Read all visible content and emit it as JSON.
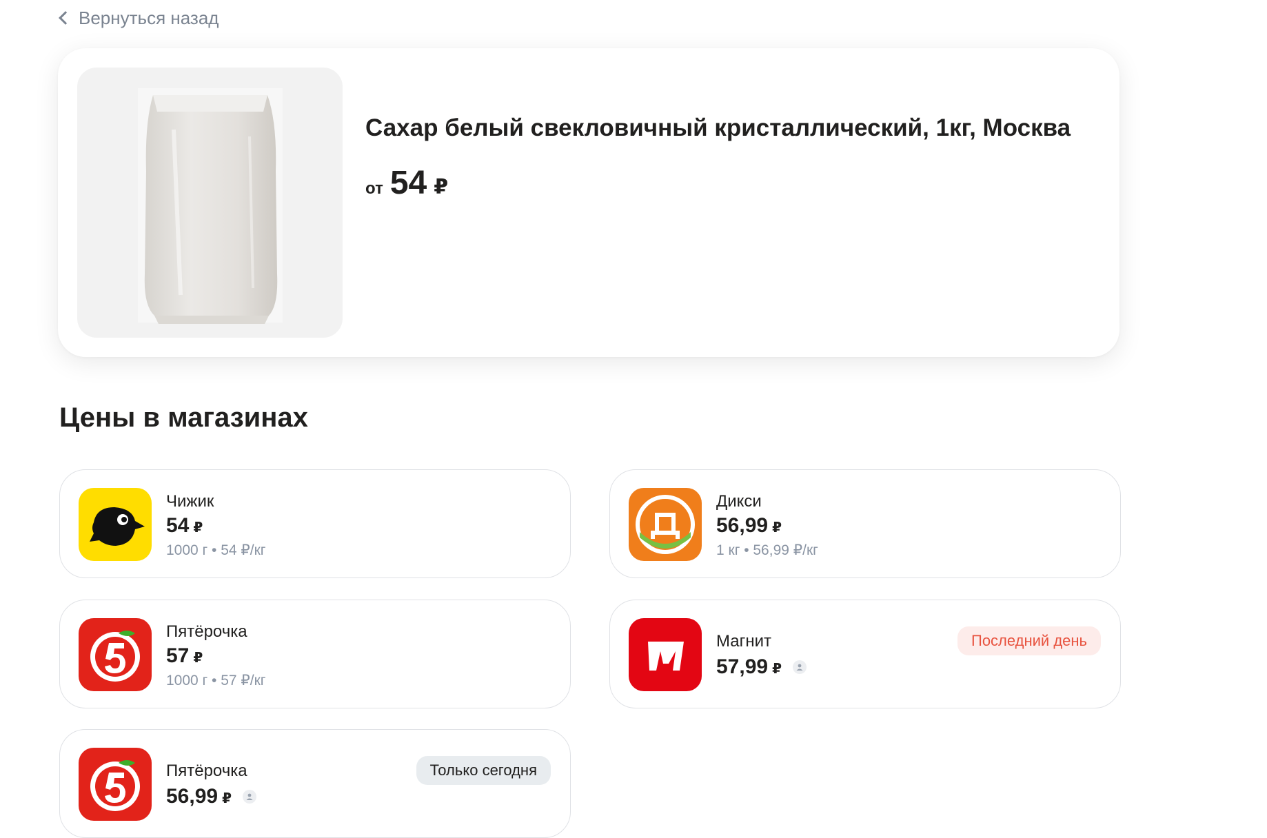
{
  "nav": {
    "back_label": "Вернуться назад"
  },
  "product": {
    "title": "Сахар белый свекловичный кристаллический, 1кг, Москва",
    "price_prefix": "от",
    "price_value": "54",
    "currency": "₽"
  },
  "section": {
    "title": "Цены в магазинах"
  },
  "offers": [
    {
      "store": "Чижик",
      "price": "54",
      "currency": "₽",
      "unit": "1000 г • 54 ₽/кг"
    },
    {
      "store": "Дикси",
      "price": "56,99",
      "currency": "₽",
      "unit": "1 кг • 56,99 ₽/кг"
    },
    {
      "store": "Пятёрочка",
      "price": "57",
      "currency": "₽",
      "unit": "1000 г • 57 ₽/кг"
    },
    {
      "store": "Магнит",
      "price": "57,99",
      "currency": "₽",
      "badge": "Последний день"
    },
    {
      "store": "Пятёрочка",
      "price": "56,99",
      "currency": "₽",
      "badge": "Только сегодня"
    }
  ],
  "colors": {
    "chizhik": "#FFDD00",
    "diksi": "#F07E1B",
    "pyaterochka": "#E2231A",
    "magnit": "#E30613",
    "badge_red_bg": "#FDECEA",
    "badge_red_text": "#E8533F",
    "badge_gray_bg": "#E8ECEF"
  },
  "icons": {
    "back": "chevron-left-icon",
    "person": "person-icon",
    "chizhik": "chizhik-bird-logo",
    "diksi": "diksi-d-logo",
    "pyaterochka": "pyaterochka-5-logo",
    "magnit": "magnit-m-logo"
  }
}
